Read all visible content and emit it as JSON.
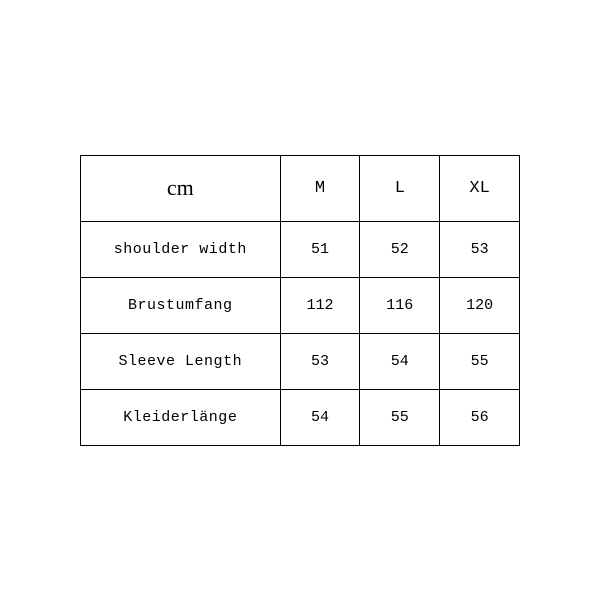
{
  "chart_data": {
    "type": "table",
    "unit": "cm",
    "sizes": [
      "M",
      "L",
      "XL"
    ],
    "measurements": [
      {
        "label": "shoulder width",
        "values": [
          51,
          52,
          53
        ]
      },
      {
        "label": "Brustumfang",
        "values": [
          112,
          116,
          120
        ]
      },
      {
        "label": "Sleeve Length",
        "values": [
          53,
          54,
          55
        ]
      },
      {
        "label": "Kleiderlänge",
        "values": [
          54,
          55,
          56
        ]
      }
    ]
  }
}
